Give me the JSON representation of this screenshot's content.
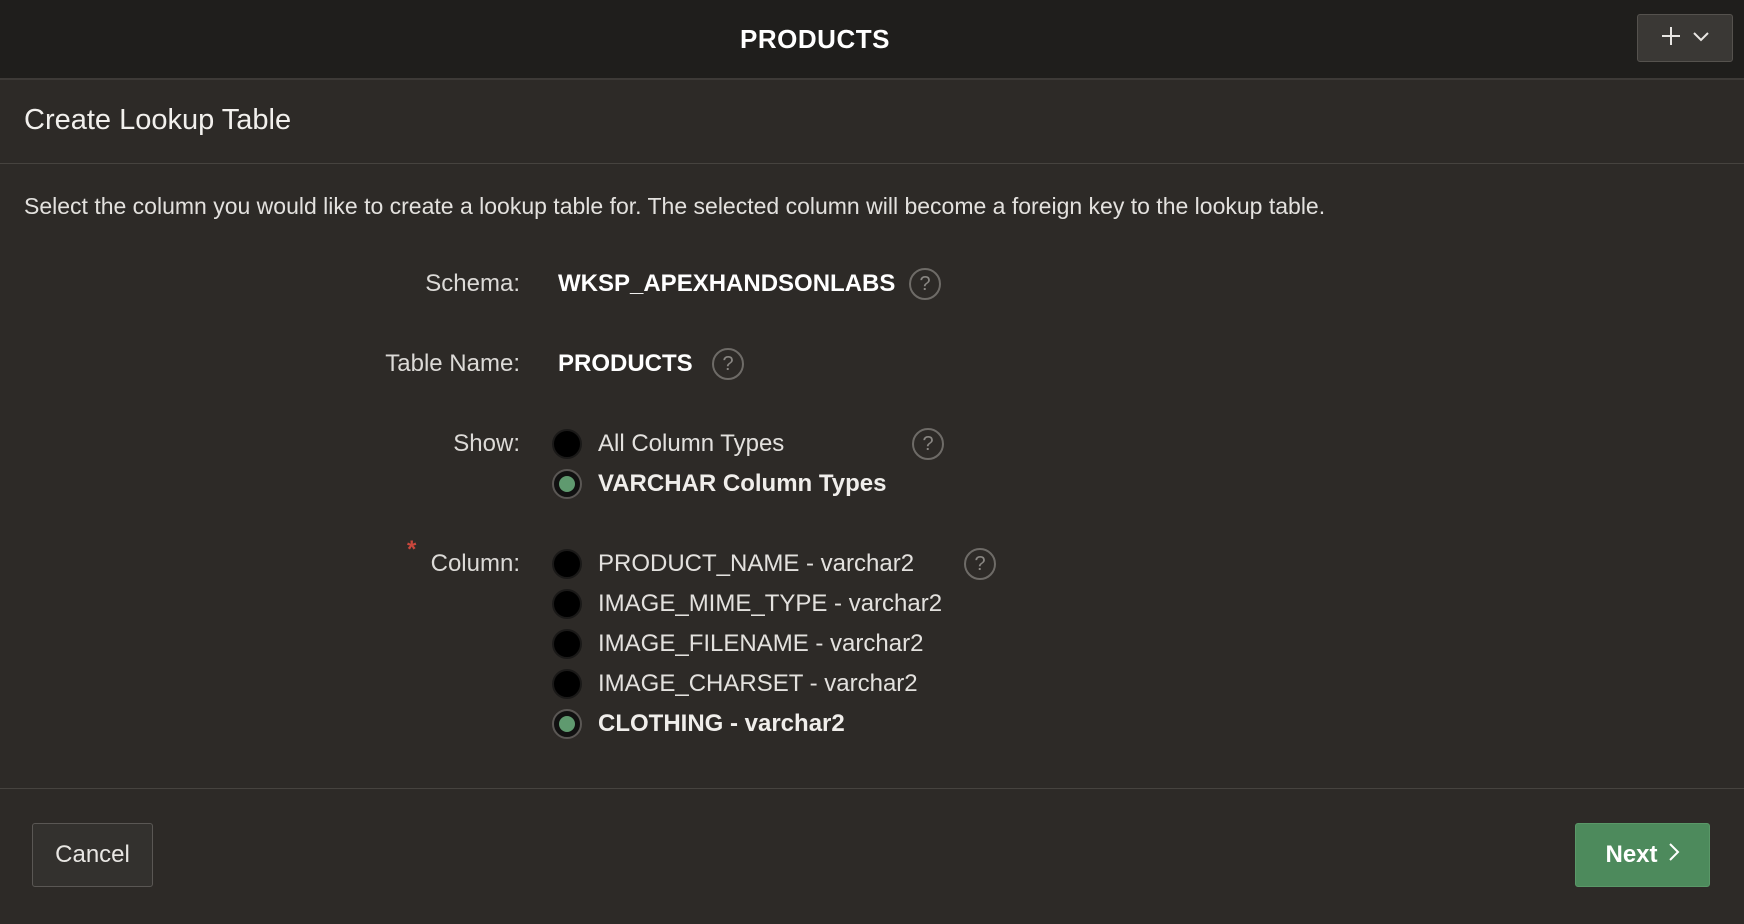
{
  "topbar": {
    "title": "PRODUCTS",
    "add_icon": "plus-icon",
    "menu_icon": "chevron-down-icon"
  },
  "region": {
    "title": "Create Lookup Table"
  },
  "instructions": "Select the column you would like to create a lookup table for. The selected column will become a foreign key to the lookup table.",
  "form": {
    "schema_label": "Schema:",
    "schema_value": "WKSP_APEXHANDSONLABS",
    "table_label": "Table Name:",
    "table_value": "PRODUCTS",
    "show_label": "Show:",
    "show_options": [
      {
        "label": "All Column Types",
        "selected": false
      },
      {
        "label": "VARCHAR Column Types",
        "selected": true
      }
    ],
    "column_label": "Column:",
    "column_required_marker": "*",
    "column_options": [
      {
        "label": "PRODUCT_NAME - varchar2",
        "selected": false
      },
      {
        "label": "IMAGE_MIME_TYPE - varchar2",
        "selected": false
      },
      {
        "label": "IMAGE_FILENAME - varchar2",
        "selected": false
      },
      {
        "label": "IMAGE_CHARSET - varchar2",
        "selected": false
      },
      {
        "label": "CLOTHING - varchar2",
        "selected": true
      }
    ],
    "help_glyph": "?"
  },
  "footer": {
    "cancel_label": "Cancel",
    "next_label": "Next",
    "next_icon": "chevron-right-icon"
  },
  "colors": {
    "background": "#2d2a27",
    "topbar": "#1f1e1c",
    "primary_button": "#4d8a5c",
    "radio_selected_dot": "#5f9a6f",
    "required": "#c9473c"
  }
}
